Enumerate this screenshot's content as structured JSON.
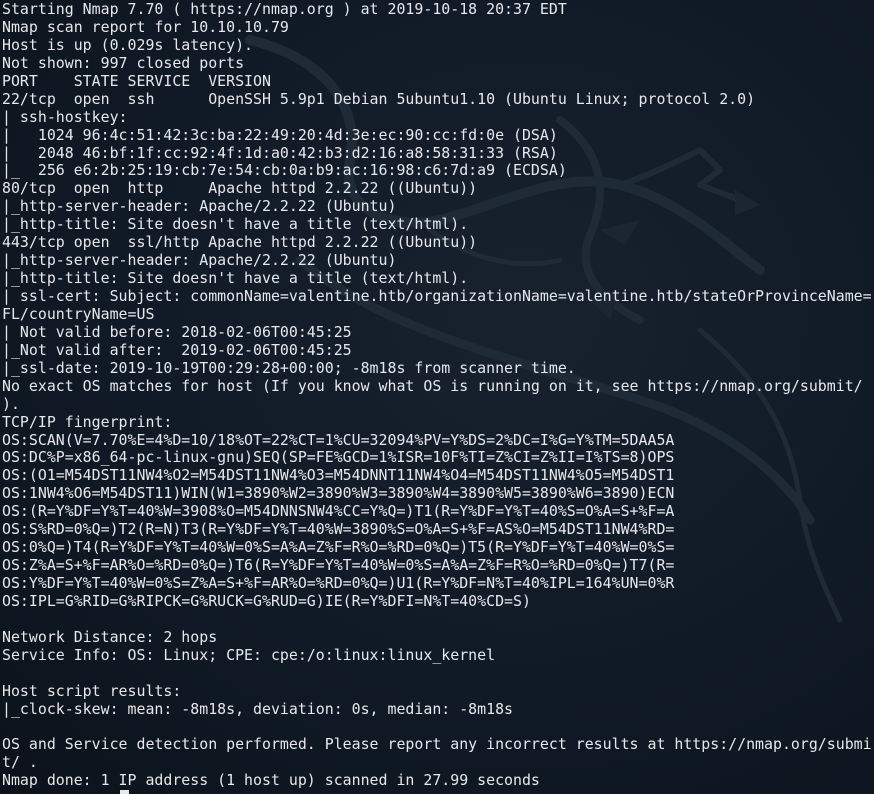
{
  "terminal": {
    "lines": [
      "Starting Nmap 7.70 ( https://nmap.org ) at 2019-10-18 20:37 EDT",
      "Nmap scan report for 10.10.10.79",
      "Host is up (0.029s latency).",
      "Not shown: 997 closed ports",
      "PORT    STATE SERVICE  VERSION",
      "22/tcp  open  ssh      OpenSSH 5.9p1 Debian 5ubuntu1.10 (Ubuntu Linux; protocol 2.0)",
      "| ssh-hostkey:",
      "|   1024 96:4c:51:42:3c:ba:22:49:20:4d:3e:ec:90:cc:fd:0e (DSA)",
      "|   2048 46:bf:1f:cc:92:4f:1d:a0:42:b3:d2:16:a8:58:31:33 (RSA)",
      "|_  256 e6:2b:25:19:cb:7e:54:cb:0a:b9:ac:16:98:c6:7d:a9 (ECDSA)",
      "80/tcp  open  http     Apache httpd 2.2.22 ((Ubuntu))",
      "|_http-server-header: Apache/2.2.22 (Ubuntu)",
      "|_http-title: Site doesn't have a title (text/html).",
      "443/tcp open  ssl/http Apache httpd 2.2.22 ((Ubuntu))",
      "|_http-server-header: Apache/2.2.22 (Ubuntu)",
      "|_http-title: Site doesn't have a title (text/html).",
      "| ssl-cert: Subject: commonName=valentine.htb/organizationName=valentine.htb/stateOrProvinceName=",
      "FL/countryName=US",
      "| Not valid before: 2018-02-06T00:45:25",
      "|_Not valid after:  2019-02-06T00:45:25",
      "|_ssl-date: 2019-10-19T00:29:28+00:00; -8m18s from scanner time.",
      "No exact OS matches for host (If you know what OS is running on it, see https://nmap.org/submit/",
      ").",
      "TCP/IP fingerprint:",
      "OS:SCAN(V=7.70%E=4%D=10/18%OT=22%CT=1%CU=32094%PV=Y%DS=2%DC=I%G=Y%TM=5DAA5A",
      "OS:DC%P=x86_64-pc-linux-gnu)SEQ(SP=FE%GCD=1%ISR=10F%TI=Z%CI=Z%II=I%TS=8)OPS",
      "OS:(O1=M54DST11NW4%O2=M54DST11NW4%O3=M54DNNT11NW4%O4=M54DST11NW4%O5=M54DST1",
      "OS:1NW4%O6=M54DST11)WIN(W1=3890%W2=3890%W3=3890%W4=3890%W5=3890%W6=3890)ECN",
      "OS:(R=Y%DF=Y%T=40%W=3908%O=M54DNNSNW4%CC=Y%Q=)T1(R=Y%DF=Y%T=40%S=O%A=S+%F=A",
      "OS:S%RD=0%Q=)T2(R=N)T3(R=Y%DF=Y%T=40%W=3890%S=O%A=S+%F=AS%O=M54DST11NW4%RD=",
      "OS:0%Q=)T4(R=Y%DF=Y%T=40%W=0%S=A%A=Z%F=R%O=%RD=0%Q=)T5(R=Y%DF=Y%T=40%W=0%S=",
      "OS:Z%A=S+%F=AR%O=%RD=0%Q=)T6(R=Y%DF=Y%T=40%W=0%S=A%A=Z%F=R%O=%RD=0%Q=)T7(R=",
      "OS:Y%DF=Y%T=40%W=0%S=Z%A=S+%F=AR%O=%RD=0%Q=)U1(R=Y%DF=N%T=40%IPL=164%UN=0%R",
      "OS:IPL=G%RID=G%RIPCK=G%RUCK=G%RUD=G)IE(R=Y%DFI=N%T=40%CD=S)",
      "",
      "Network Distance: 2 hops",
      "Service Info: OS: Linux; CPE: cpe:/o:linux:linux_kernel",
      "",
      "Host script results:",
      "|_clock-skew: mean: -8m18s, deviation: 0s, median: -8m18s",
      "",
      "OS and Service detection performed. Please report any incorrect results at https://nmap.org/submi",
      "t/ .",
      "Nmap done: 1 IP address (1 host up) scanned in 27.99 seconds"
    ]
  },
  "colors": {
    "background": "#0d1521",
    "text": "#e6e8eb",
    "watermark": "#1e2835"
  },
  "icons": {
    "watermark": "kali-dragon-icon",
    "cursor": "text-cursor"
  }
}
